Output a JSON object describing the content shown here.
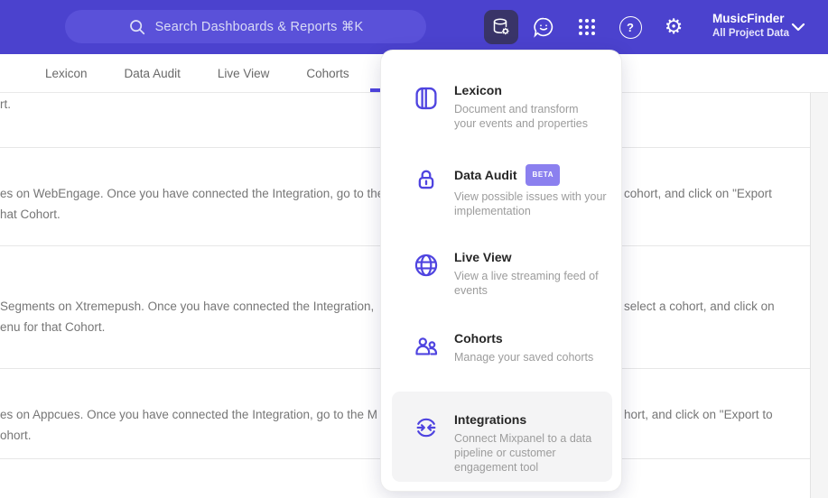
{
  "colors": {
    "accent": "#4f44e0",
    "header_bg": "#4b42ce",
    "active_button_bg": "#393468",
    "badge_bg": "#8b80ef",
    "highlight_bg": "#f4f4f5"
  },
  "header": {
    "search_placeholder": "Search Dashboards & Reports ⌘K",
    "project_name": "MusicFinder",
    "project_scope": "All Project Data",
    "help_glyph": "?",
    "gear_glyph": "⚙"
  },
  "nav": {
    "tabs": [
      {
        "label": "Lexicon"
      },
      {
        "label": "Data Audit"
      },
      {
        "label": "Live View"
      },
      {
        "label": "Cohorts"
      }
    ]
  },
  "menu": {
    "items": [
      {
        "title": "Lexicon",
        "description": "Document and transform\nyour events and properties"
      },
      {
        "title": "Data Audit",
        "badge": "BETA",
        "description": "View possible issues with your\nimplementation"
      },
      {
        "title": "Live View",
        "description": "View a live streaming feed of\nevents"
      },
      {
        "title": "Cohorts",
        "description": "Manage your saved cohorts"
      },
      {
        "title": "Integrations",
        "description": "Connect Mixpanel to a data\npipeline or customer\nengagement tool"
      }
    ]
  },
  "content": {
    "rows": [
      {
        "l1_left": "rt.",
        "l1_right": "",
        "l2": ""
      },
      {
        "l1_left": "es on WebEngage. Once you have connected the Integration, go to the",
        "l1_right": "cohort, and click on \"Export",
        "l2": "hat Cohort."
      },
      {
        "l1_left": "Segments on Xtremepush. Once you have connected the Integration,",
        "l1_right": "select a cohort, and click on",
        "l2": "enu for that Cohort."
      },
      {
        "l1_left": "es on Appcues. Once you have connected the Integration, go to the M",
        "l1_right": "hort, and click on \"Export to",
        "l2": "ohort."
      }
    ]
  },
  "icons": {
    "search": "search-icon",
    "data_management": "database-gear-icon",
    "feedback": "feedback-smiley-bubble-icon",
    "apps": "apps-grid-icon",
    "help": "help-icon",
    "settings": "settings-gear-icon",
    "chevron": "chevron-down-icon",
    "lexicon": "lexicon-book-icon",
    "data_audit": "data-audit-lock-icon",
    "live_view": "live-view-globe-icon",
    "cohorts": "cohorts-people-icon",
    "integrations": "integrations-sync-icon"
  }
}
